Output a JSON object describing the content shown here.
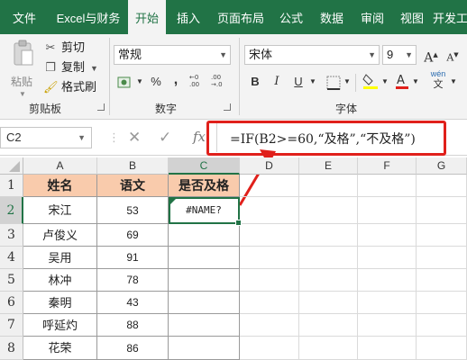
{
  "tabs": [
    "文件",
    "Excel与财务",
    "开始",
    "插入",
    "页面布局",
    "公式",
    "数据",
    "审阅",
    "视图",
    "开发工"
  ],
  "active_tab": "开始",
  "clipboard": {
    "paste": "粘贴",
    "cut": "剪切",
    "copy": "复制",
    "format_painter": "格式刷",
    "group_label": "剪贴板"
  },
  "number": {
    "format_value": "常规",
    "percent": "%",
    "comma": ",",
    "group_label": "数字"
  },
  "font": {
    "font_name": "宋体",
    "font_size": "9",
    "bold": "B",
    "italic": "I",
    "underline": "U",
    "group_label": "字体"
  },
  "formula_bar": {
    "name_box": "C2",
    "fx": "fx",
    "formula": "=IF(B2>=60,“及格”,“不及格”)"
  },
  "columns": [
    "A",
    "B",
    "C",
    "D",
    "E",
    "F",
    "G"
  ],
  "selected_column": "C",
  "rows": [
    "1",
    "2",
    "3",
    "4",
    "5",
    "6",
    "7",
    "8"
  ],
  "selected_row": "2",
  "table": {
    "headers": [
      "姓名",
      "语文",
      "是否及格"
    ],
    "names": [
      "宋江",
      "卢俊义",
      "吴用",
      "林冲",
      "秦明",
      "呼延灼",
      "花荣"
    ],
    "scores": [
      "53",
      "69",
      "91",
      "78",
      "43",
      "88",
      "86"
    ],
    "results": [
      "#NAME?",
      "",
      "",
      "",
      "",
      "",
      ""
    ]
  },
  "colors": {
    "ribbon_green": "#217346",
    "header_fill": "#f9cbac",
    "highlight_red": "#e0201b"
  }
}
